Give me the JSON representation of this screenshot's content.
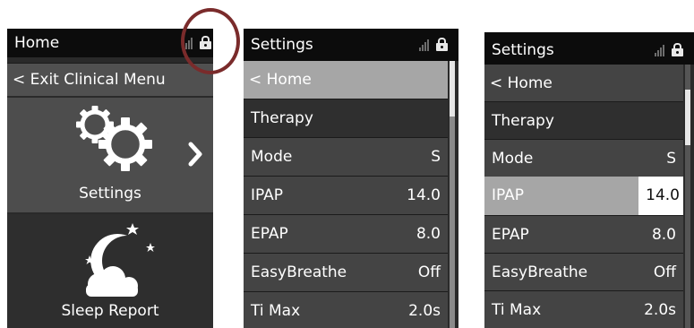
{
  "home": {
    "title": "Home",
    "exit_label": "< Exit Clinical Menu",
    "settings_label": "Settings",
    "sleep_label": "Sleep Report"
  },
  "settings_a": {
    "title": "Settings",
    "rows": [
      {
        "label": "< Home",
        "value": ""
      },
      {
        "label": "Therapy",
        "value": ""
      },
      {
        "label": "Mode",
        "value": "S"
      },
      {
        "label": "IPAP",
        "value": "14.0"
      },
      {
        "label": "EPAP",
        "value": "8.0"
      },
      {
        "label": "EasyBreathe",
        "value": "Off"
      },
      {
        "label": "Ti Max",
        "value": "2.0s"
      }
    ]
  },
  "settings_b": {
    "title": "Settings",
    "rows": [
      {
        "label": "< Home",
        "value": ""
      },
      {
        "label": "Therapy",
        "value": ""
      },
      {
        "label": "Mode",
        "value": "S"
      },
      {
        "label": "IPAP",
        "value": "14.0"
      },
      {
        "label": "EPAP",
        "value": "8.0"
      },
      {
        "label": "EasyBreathe",
        "value": "Off"
      },
      {
        "label": "Ti Max",
        "value": "2.0s"
      }
    ]
  },
  "colors": {
    "status_bar": "#0c0c0c",
    "row_bg": "#444444",
    "highlight": "#a6a6a6",
    "annotation_circle": "#7a2b2b"
  },
  "icons": {
    "status": [
      "signal-bars-icon",
      "lock-icon"
    ],
    "menu": [
      "gears-icon",
      "chevron-right-icon",
      "moon-cloud-icon",
      "chevron-left-icon"
    ]
  }
}
